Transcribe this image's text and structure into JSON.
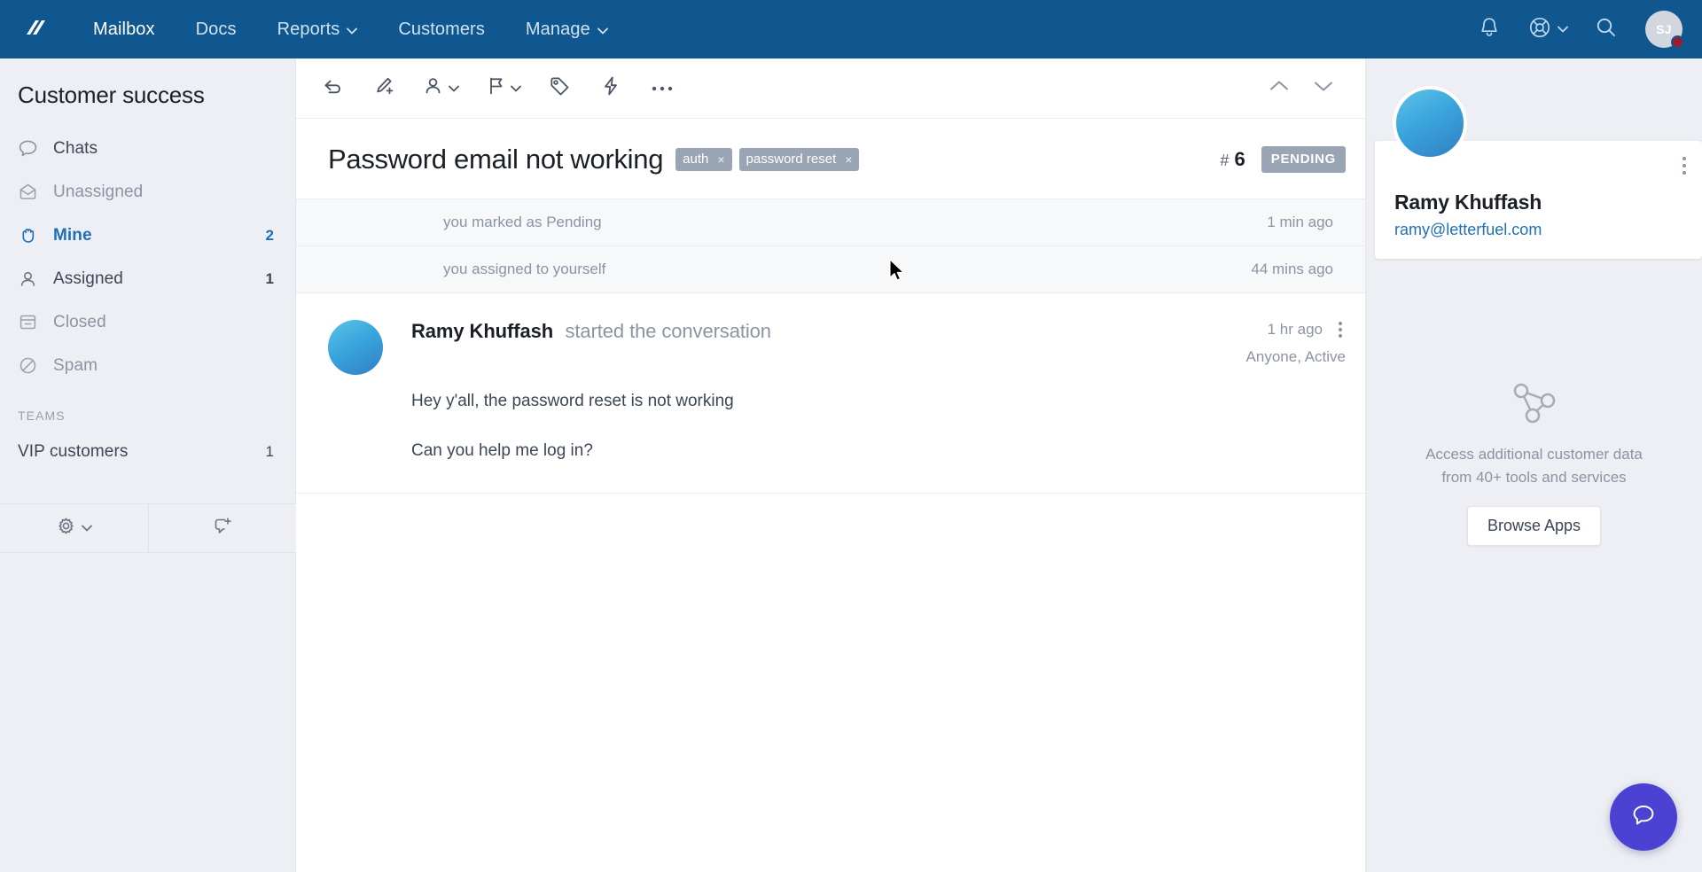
{
  "topnav": {
    "brand_icon": "helpscout-logo-icon",
    "links": [
      {
        "label": "Mailbox",
        "active": true,
        "caret": false
      },
      {
        "label": "Docs",
        "active": false,
        "caret": false
      },
      {
        "label": "Reports",
        "active": false,
        "caret": true
      },
      {
        "label": "Customers",
        "active": false,
        "caret": false
      },
      {
        "label": "Manage",
        "active": false,
        "caret": true
      }
    ],
    "caret_glyph": "⌄",
    "notifications_icon": "bell-icon",
    "help_icon": "lifebuoy-icon",
    "search_icon": "search-icon",
    "avatar_initials": "SJ",
    "brand_color": "#10578f",
    "badge_color": "#9b1c31"
  },
  "sidebar": {
    "title": "Customer success",
    "folders": [
      {
        "label": "Chats",
        "icon": "chat-bubble-icon",
        "count": "",
        "state": "normal"
      },
      {
        "label": "Unassigned",
        "icon": "envelope-open-icon",
        "count": "",
        "state": "muted"
      },
      {
        "label": "Mine",
        "icon": "raised-hand-icon",
        "count": "2",
        "state": "active"
      },
      {
        "label": "Assigned",
        "icon": "person-icon",
        "count": "1",
        "state": "normal"
      },
      {
        "label": "Closed",
        "icon": "archive-box-icon",
        "count": "",
        "state": "muted"
      },
      {
        "label": "Spam",
        "icon": "no-entry-icon",
        "count": "",
        "state": "muted"
      }
    ],
    "teams_heading": "TEAMS",
    "teams": [
      {
        "label": "VIP customers",
        "count": "1"
      }
    ],
    "bottom_tools": [
      {
        "icon": "gear-icon",
        "name": "mailbox-settings"
      },
      {
        "icon": "new-conversation-icon",
        "name": "new-conversation"
      }
    ],
    "accent_color": "#1f6fb5"
  },
  "toolbar": {
    "buttons": [
      {
        "icon": "reply-arrow-icon",
        "name": "reply",
        "caret": false
      },
      {
        "icon": "pencil-plus-icon",
        "name": "add-note",
        "caret": false
      },
      {
        "icon": "person-icon",
        "name": "assign",
        "caret": true
      },
      {
        "icon": "flag-icon",
        "name": "status",
        "caret": true
      },
      {
        "icon": "tag-icon",
        "name": "tags",
        "caret": false
      },
      {
        "icon": "lightning-bolt-icon",
        "name": "workflows",
        "caret": false
      },
      {
        "icon": "ellipsis-icon",
        "name": "more-actions",
        "caret": false
      }
    ],
    "prev_icon": "chevron-up-icon",
    "next_icon": "chevron-down-icon"
  },
  "conversation": {
    "title": "Password email not working",
    "tags": [
      {
        "label": "auth",
        "remove": "×"
      },
      {
        "label": "password reset",
        "remove": "×"
      }
    ],
    "number_hash": "#",
    "number": "6",
    "status": "PENDING",
    "status_color": "#99a4b4",
    "activity": [
      {
        "text": "you marked as Pending",
        "time": "1 min ago"
      },
      {
        "text": "you assigned to yourself",
        "time": "44 mins ago"
      }
    ],
    "thread": {
      "author": "Ramy Khuffash",
      "action": "started the conversation",
      "time": "1 hr ago",
      "visibility": "Anyone, Active",
      "kebab_icon": "kebab-menu-icon",
      "avatar_icon": "customer-avatar",
      "paragraphs": [
        "Hey y'all, the password reset is not working",
        "Can you help me log in?"
      ]
    }
  },
  "rightpanel": {
    "customer": {
      "avatar_icon": "customer-avatar",
      "name": "Ramy Khuffash",
      "email": "ramy@letterfuel.com",
      "kebab_icon": "kebab-menu-icon"
    },
    "apps": {
      "icon": "network-nodes-icon",
      "line1": "Access additional customer data",
      "line2": "from 40+ tools and services",
      "button": "Browse Apps"
    }
  },
  "beacon": {
    "icon": "chat-bubble-icon",
    "color": "#4b42d4"
  }
}
